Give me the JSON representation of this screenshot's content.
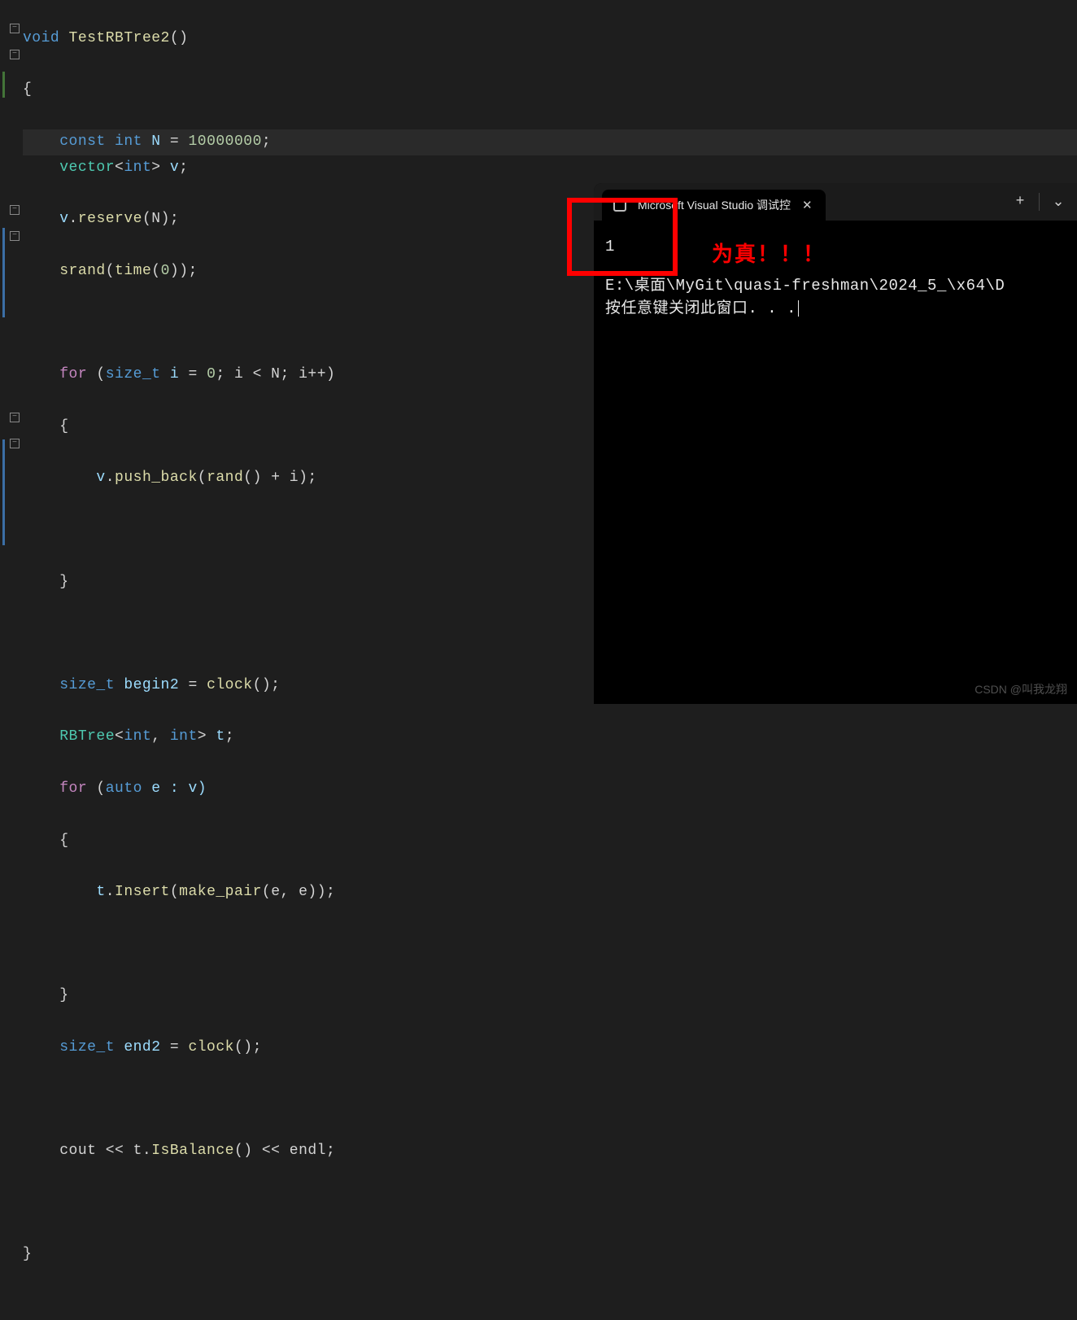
{
  "code": {
    "l1_kw": "void",
    "l1_fn": "TestRBTree2",
    "l1_p": "()",
    "l2": "{",
    "l3_kw": "const int",
    "l3_var": "N",
    "l3_eq": " = ",
    "l3_num": "10000000",
    "l3_sc": ";",
    "l4_ty": "vector",
    "l4_lt": "<",
    "l4_in": "int",
    "l4_gt": "> ",
    "l4_v": "v",
    "l4_sc": ";",
    "l5_v": "v",
    "l5_dot": ".",
    "l5_fn": "reserve",
    "l5_p": "(N);",
    "l6_fn": "srand",
    "l6_a": "(",
    "l6_fn2": "time",
    "l6_b": "(",
    "l6_z": "0",
    "l6_c": "));",
    "l8_kw": "for",
    "l8_a": " (",
    "l8_ty": "size_t",
    "l8_v": " i",
    "l8_eq": " = ",
    "l8_z": "0",
    "l8_b": "; i < N; i++)",
    "l9": "{",
    "l10_v": "v",
    "l10_dot": ".",
    "l10_fn": "push_back",
    "l10_a": "(",
    "l10_fn2": "rand",
    "l10_b": "() + i);",
    "l12": "}",
    "l14_ty": "size_t",
    "l14_v": " begin2",
    "l14_eq": " = ",
    "l14_fn": "clock",
    "l14_p": "();",
    "l15_ty": "RBTree",
    "l15_lt": "<",
    "l15_in": "int",
    "l15_c": ", ",
    "l15_in2": "int",
    "l15_gt": "> ",
    "l15_v": "t",
    "l15_sc": ";",
    "l16_kw": "for",
    "l16_a": " (",
    "l16_ty": "auto",
    "l16_v": " e : v)",
    "l17": "{",
    "l18_v": "t",
    "l18_dot": ".",
    "l18_fn": "Insert",
    "l18_a": "(",
    "l18_fn2": "make_pair",
    "l18_b": "(e, e));",
    "l20": "}",
    "l21_ty": "size_t",
    "l21_v": " end2",
    "l21_eq": " = ",
    "l21_fn": "clock",
    "l21_p": "();",
    "l23_a": "cout << t.",
    "l23_fn": "IsBalance",
    "l23_b": "() << endl;",
    "l25": "}"
  },
  "console": {
    "tab_title": "Microsoft Visual Studio 调试控",
    "output_value": "1",
    "path_line": "E:\\桌面\\MyGit\\quasi-freshman\\2024_5_\\x64\\D",
    "close_prompt": "按任意键关闭此窗口. . ."
  },
  "annotation": "为真！！！",
  "watermark": "CSDN @叫我龙翔",
  "glyphs": {
    "fold_minus": "−",
    "close_x": "✕",
    "plus": "+",
    "chev_down": "⌄"
  }
}
